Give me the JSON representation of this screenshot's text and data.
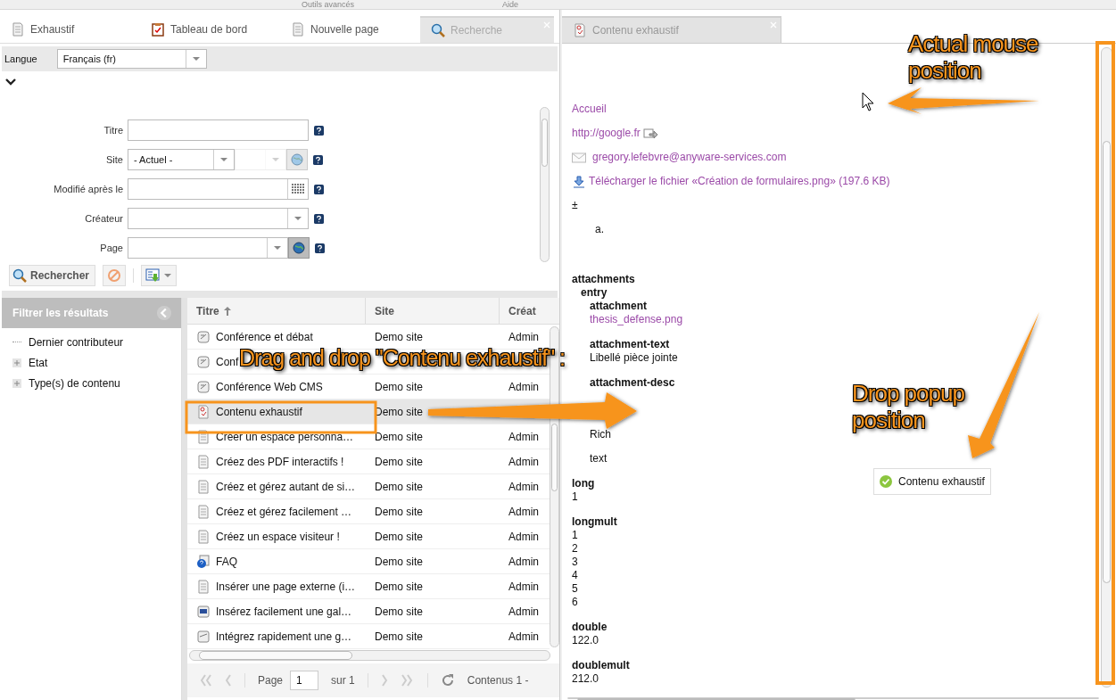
{
  "top_menu": [
    "Outils avancés",
    "Aide"
  ],
  "left_tabs": [
    {
      "label": "Exhaustif",
      "kind": "page",
      "selected": false
    },
    {
      "label": "Tableau de bord",
      "kind": "clipboard",
      "selected": false
    },
    {
      "label": "Nouvelle page",
      "kind": "page",
      "selected": false
    },
    {
      "label": "Recherche",
      "kind": "search",
      "selected": true
    }
  ],
  "language": {
    "label": "Langue",
    "value": "Français (fr)"
  },
  "search_form": {
    "fields": [
      {
        "label": "Titre",
        "kind": "text"
      },
      {
        "label": "Site",
        "kind": "site",
        "value": "- Actuel -"
      },
      {
        "label": "Modifié après le",
        "kind": "date"
      },
      {
        "label": "Créateur",
        "kind": "select"
      },
      {
        "label": "Page",
        "kind": "page"
      }
    ],
    "search_button": "Rechercher"
  },
  "filter_panel": {
    "title": "Filtrer les résultats",
    "items": [
      {
        "label": "Dernier contributeur",
        "expandable": false
      },
      {
        "label": "Etat",
        "expandable": true
      },
      {
        "label": "Type(s) de contenu",
        "expandable": true
      }
    ]
  },
  "grid": {
    "columns": [
      {
        "label": "Titre",
        "sorted": true
      },
      {
        "label": "Site",
        "sorted": false
      },
      {
        "label": "Créat",
        "sorted": false
      }
    ],
    "rows": [
      {
        "kind": "conference",
        "title": "Conférence et débat",
        "site": "Demo site",
        "creator": "Admin",
        "selected": false
      },
      {
        "kind": "conference",
        "title": "Conf",
        "selected": false
      },
      {
        "kind": "conference",
        "title": "Conférence Web CMS",
        "site": "Demo site",
        "creator": "Admin",
        "selected": false
      },
      {
        "kind": "exhaustive",
        "title": "Contenu exhaustif",
        "site": "Demo site",
        "selected": true
      },
      {
        "kind": "page",
        "title": "Créer un espace personna…",
        "site": "Demo site",
        "creator": "Admin",
        "selected": false
      },
      {
        "kind": "page",
        "title": "Créez des PDF interactifs !",
        "site": "Demo site",
        "creator": "Admin",
        "selected": false
      },
      {
        "kind": "page",
        "title": "Créez et gérez autant de si…",
        "site": "Demo site",
        "creator": "Admin",
        "selected": false
      },
      {
        "kind": "page",
        "title": "Créez et gérez facilement …",
        "site": "Demo site",
        "creator": "Admin",
        "selected": false
      },
      {
        "kind": "page",
        "title": "Créez un espace visiteur !",
        "site": "Demo site",
        "creator": "Admin",
        "selected": false
      },
      {
        "kind": "faq",
        "title": "FAQ",
        "site": "Demo site",
        "creator": "Admin",
        "selected": false
      },
      {
        "kind": "page",
        "title": "Insérer une page externe (i…",
        "site": "Demo site",
        "creator": "Admin",
        "selected": false
      },
      {
        "kind": "gallery",
        "title": "Insérez facilement une gal…",
        "site": "Demo site",
        "creator": "Admin",
        "selected": false
      },
      {
        "kind": "video",
        "title": "Intégrez rapidement une g…",
        "site": "Demo site",
        "creator": "Admin",
        "selected": false
      }
    ]
  },
  "pager": {
    "page_label": "Page",
    "page": "1",
    "of": "sur 1",
    "summary": "Contenus 1 -"
  },
  "right_tab": {
    "label": "Contenu exhaustif"
  },
  "content": [
    {
      "kind": "link",
      "text": "Accueil"
    },
    {
      "kind": "url",
      "text": "http://google.fr"
    },
    {
      "kind": "email",
      "text": "gregory.lefebvre@anyware-services.com"
    },
    {
      "kind": "download",
      "text": "Télécharger le fichier «Création de formulaires.png» (197.6 KB)"
    },
    {
      "kind": "text",
      "text": "±"
    },
    {
      "kind": "list",
      "text": "a."
    },
    {
      "kind": "group",
      "label": "attachments",
      "children": [
        {
          "kind": "group",
          "label": "entry",
          "children": [
            {
              "kind": "file-field",
              "label": "attachment",
              "values": [
                "thesis_defense.png"
              ]
            },
            {
              "kind": "field",
              "label": "attachment-text",
              "values": [
                "Libellé pièce jointe"
              ]
            },
            {
              "kind": "rich",
              "label": "attachment-desc",
              "paragraphs": [
                "Rich",
                "text"
              ]
            }
          ]
        }
      ]
    },
    {
      "kind": "field",
      "label": "long",
      "values": [
        "1"
      ]
    },
    {
      "kind": "field",
      "label": "longmult",
      "values": [
        "1",
        "2",
        "3",
        "4",
        "5",
        "6"
      ]
    },
    {
      "kind": "field",
      "label": "double",
      "values": [
        "122.0"
      ]
    },
    {
      "kind": "field",
      "label": "doublemult",
      "values": [
        "212.0"
      ]
    }
  ],
  "drop_popup": {
    "label": "Contenu exhaustif"
  },
  "annotations": [
    {
      "text": "Actual mouse position"
    },
    {
      "text": "Drag and drop \"Contenu exhaustif\" :"
    },
    {
      "text": "Drop popup position"
    }
  ]
}
